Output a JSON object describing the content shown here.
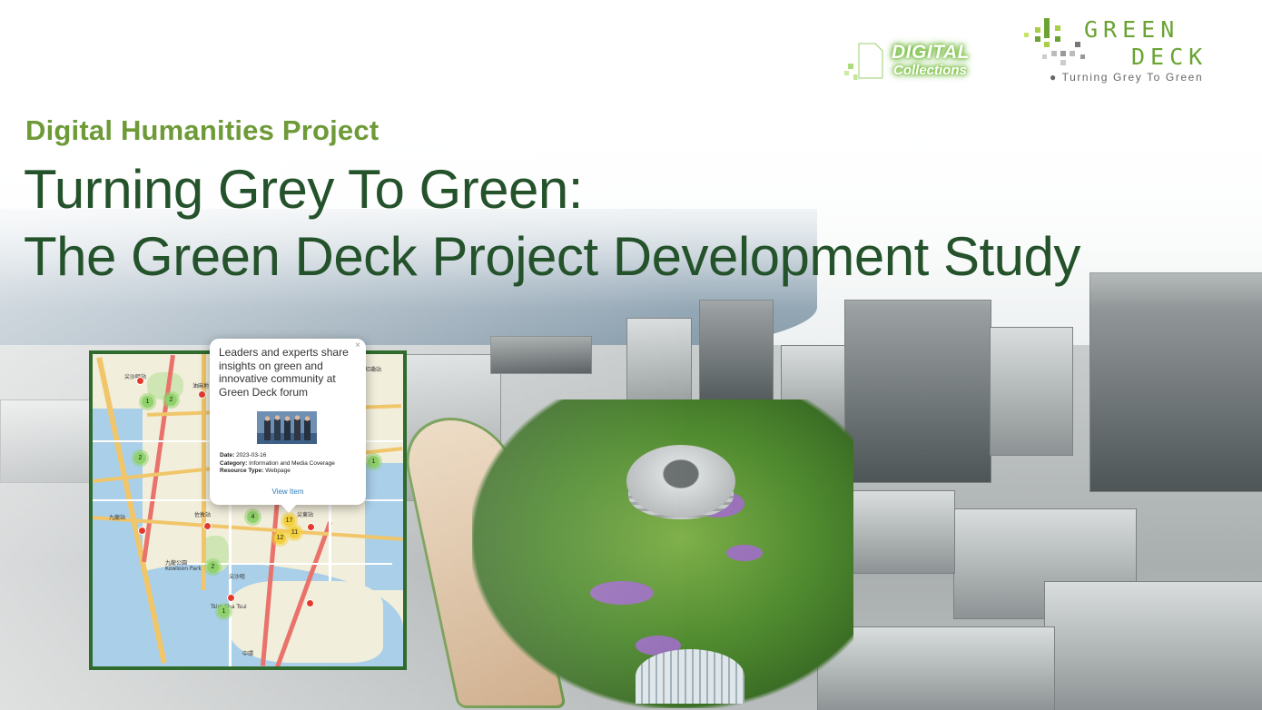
{
  "header": {
    "subtitle": "Digital Humanities Project",
    "title_line1": "Turning Grey To Green:",
    "title_line2": "The Green Deck Project Development Study"
  },
  "logos": {
    "digital_collections": {
      "line1": "DIGITAL",
      "line2": "Collections"
    },
    "green_deck": {
      "word1": "GREEN",
      "word2": "DECK",
      "tagline": "Turning Grey To Green"
    }
  },
  "map": {
    "labels": [
      "紅磡站",
      "九龍站",
      "尖東站",
      "尖沙咀",
      "油麻地",
      "佐敦站",
      "尖沙咀站",
      "九龍公園",
      "中環",
      "Tsim Sha Tsui",
      "Kowloon Park"
    ],
    "clusters": [
      {
        "count": "1",
        "color": "green"
      },
      {
        "count": "2",
        "color": "green"
      },
      {
        "count": "2",
        "color": "green"
      },
      {
        "count": "1",
        "color": "green"
      },
      {
        "count": "4",
        "color": "green"
      },
      {
        "count": "2",
        "color": "green"
      },
      {
        "count": "17",
        "color": "yellow"
      },
      {
        "count": "12",
        "color": "yellow"
      },
      {
        "count": "11",
        "color": "yellow"
      },
      {
        "count": "1",
        "color": "green"
      }
    ],
    "popup": {
      "close": "×",
      "title": "Leaders and experts share insights on green and innovative community at Green Deck forum",
      "date_label": "Date:",
      "date": "2023-03-16",
      "category_label": "Category:",
      "category": "Information and Media Coverage",
      "resource_label": "Resource Type:",
      "resource": "Webpage",
      "link": "View Item"
    }
  },
  "colors": {
    "title": "#24522b",
    "subtitle": "#6e9a38",
    "map_border": "#2f6b2c",
    "link": "#2a7ab9"
  }
}
